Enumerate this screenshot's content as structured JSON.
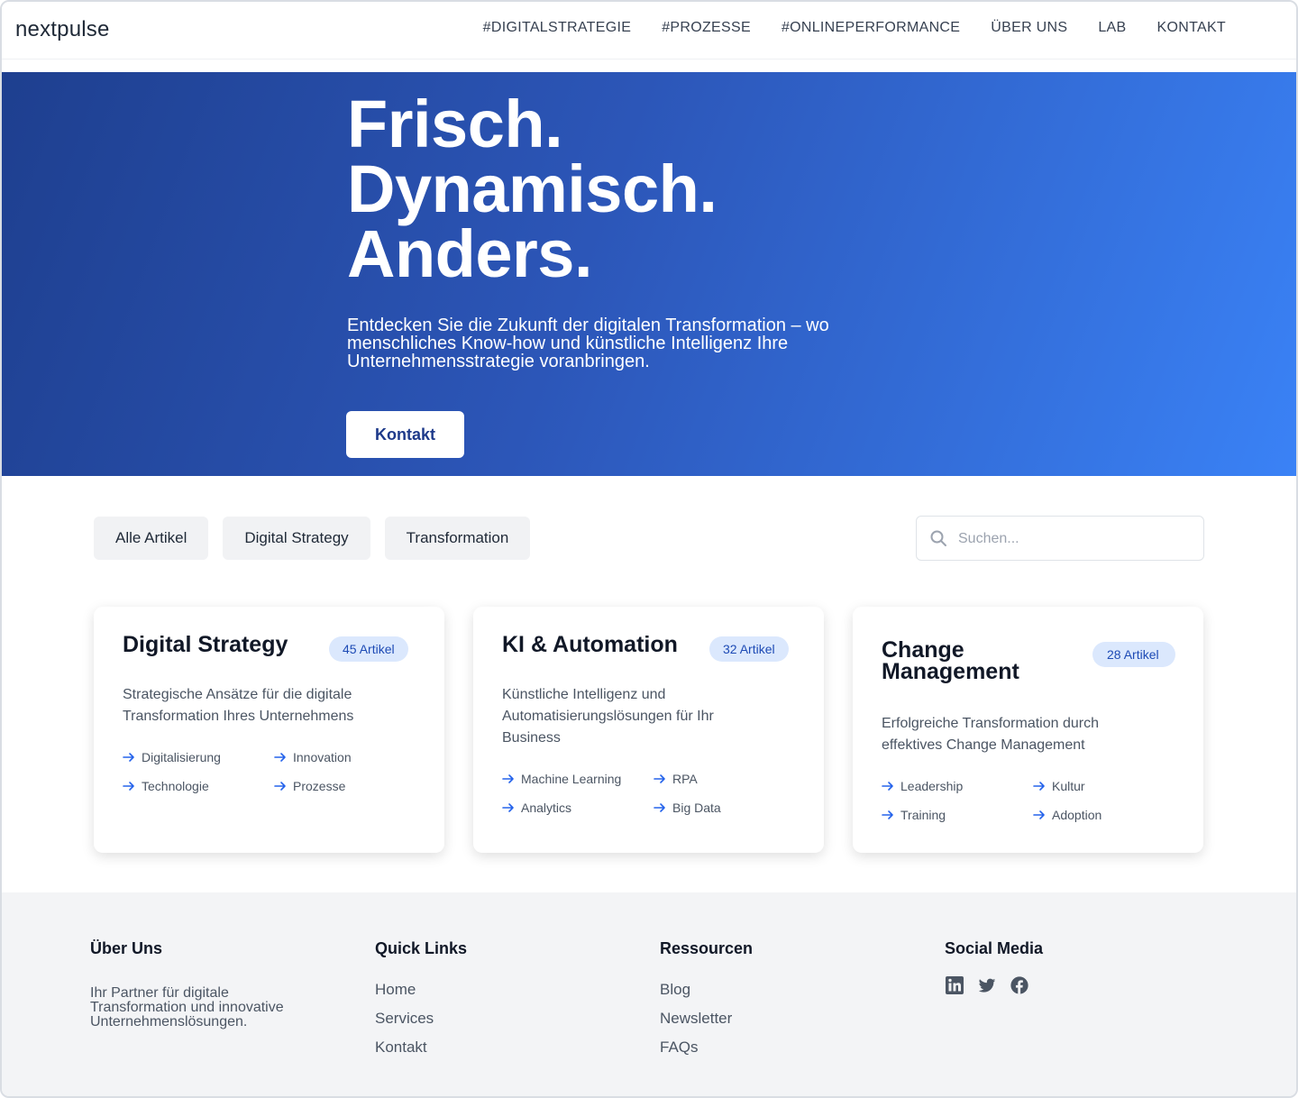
{
  "header": {
    "logo": "nextpulse",
    "nav": [
      "#DIGITALSTRATEGIE",
      "#PROZESSE",
      "#ONLINEPERFORMANCE",
      "ÜBER UNS",
      "LAB",
      "KONTAKT"
    ]
  },
  "hero": {
    "headline": [
      "Frisch.",
      "Dynamisch.",
      "Anders."
    ],
    "lead": "Entdecken Sie die Zukunft der digitalen Transformation – wo menschliches Know-how und künstliche Intelligenz Ihre Unternehmensstrategie voranbringen.",
    "cta": "Kontakt"
  },
  "filters": [
    "Alle Artikel",
    "Digital Strategy",
    "Transformation"
  ],
  "search": {
    "placeholder": "Suchen..."
  },
  "cards": [
    {
      "title": "Digital Strategy",
      "badge": "45 Artikel",
      "desc": "Strategische Ansätze für die digitale Transformation Ihres Unternehmens",
      "tags": [
        "Digitalisierung",
        "Innovation",
        "Technologie",
        "Prozesse"
      ]
    },
    {
      "title": "KI & Automation",
      "badge": "32 Artikel",
      "desc": "Künstliche Intelligenz und Automatisierungslösungen für Ihr Business",
      "tags": [
        "Machine Learning",
        "RPA",
        "Analytics",
        "Big Data"
      ]
    },
    {
      "title": "Change Management",
      "badge": "28 Artikel",
      "desc": "Erfolgreiche Transformation durch effektives Change Management",
      "tags": [
        "Leadership",
        "Kultur",
        "Training",
        "Adoption"
      ]
    }
  ],
  "footer": {
    "about": {
      "title": "Über Uns",
      "text": "Ihr Partner für digitale Transformation und innovative Unternehmenslösungen."
    },
    "quick": {
      "title": "Quick Links",
      "links": [
        "Home",
        "Services",
        "Kontakt"
      ]
    },
    "resources": {
      "title": "Ressourcen",
      "links": [
        "Blog",
        "Newsletter",
        "FAQs"
      ]
    },
    "social": {
      "title": "Social Media",
      "icons": [
        "linkedin-icon",
        "twitter-icon",
        "facebook-icon"
      ]
    }
  },
  "colors": {
    "accent": "#3a82f6",
    "hero_dark": "#1e3f8f",
    "badge_bg": "#dbe8fd",
    "badge_text": "#1e4bb5"
  }
}
